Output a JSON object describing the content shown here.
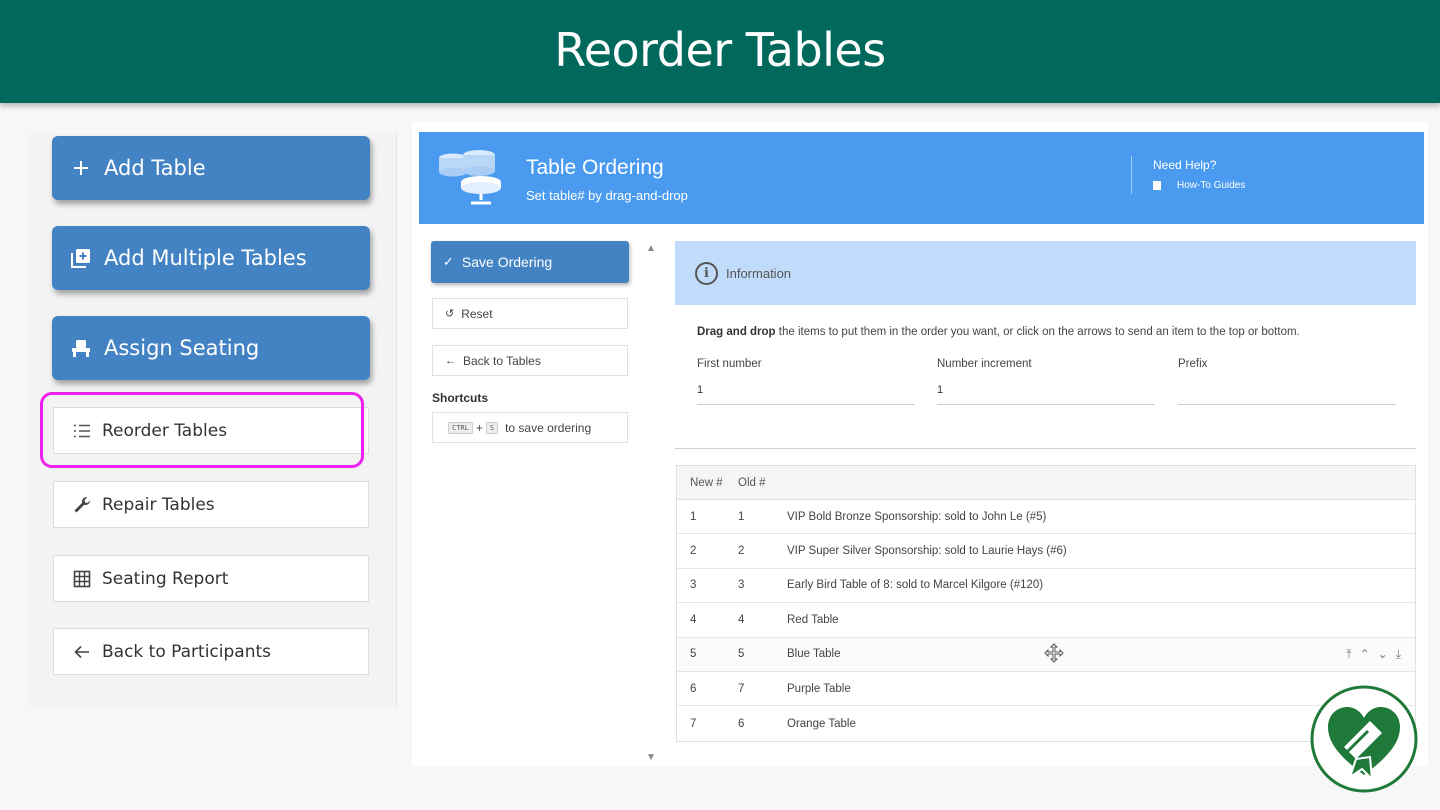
{
  "banner": {
    "title": "Reorder Tables"
  },
  "left_menu": {
    "add_table": "Add Table",
    "add_multiple": "Add Multiple Tables",
    "assign_seating": "Assign Seating",
    "reorder_tables": "Reorder Tables",
    "repair_tables": "Repair Tables",
    "seating_report": "Seating Report",
    "back_participants": "Back to Participants"
  },
  "header": {
    "title": "Table Ordering",
    "subtitle": "Set table# by drag-and-drop",
    "help_title": "Need Help?",
    "help_link": "How-To Guides"
  },
  "sidebar": {
    "save": "Save Ordering",
    "reset": "Reset",
    "back": "Back to Tables",
    "shortcuts_title": "Shortcuts",
    "key_ctrl": "CTRL",
    "key_plus": "+",
    "key_s": "S",
    "shortcut_desc": "to save ordering"
  },
  "info": {
    "title": "Information",
    "desc_bold": "Drag and drop",
    "desc_rest": " the items to put them in the order you want, or click on the arrows to send an item to the top or bottom.",
    "fields": [
      {
        "label": "First number",
        "value": "1"
      },
      {
        "label": "Number increment",
        "value": "1"
      },
      {
        "label": "Prefix",
        "value": ""
      }
    ]
  },
  "table": {
    "headers": {
      "new": "New #",
      "old": "Old #"
    },
    "rows": [
      {
        "new": "1",
        "old": "1",
        "name": "VIP Bold Bronze Sponsorship: sold to John Le (#5)"
      },
      {
        "new": "2",
        "old": "2",
        "name": "VIP Super Silver Sponsorship: sold to Laurie Hays (#6)"
      },
      {
        "new": "3",
        "old": "3",
        "name": "Early Bird Table of 8: sold to Marcel Kilgore (#120)"
      },
      {
        "new": "4",
        "old": "4",
        "name": "Red Table"
      },
      {
        "new": "5",
        "old": "5",
        "name": "Blue Table"
      },
      {
        "new": "6",
        "old": "7",
        "name": "Purple Table"
      },
      {
        "new": "7",
        "old": "6",
        "name": "Orange Table"
      }
    ]
  },
  "icons": {
    "add": "plus-icon",
    "add_multiple": "library-add-icon",
    "seating": "seat-icon",
    "reorder": "list-numbered-icon",
    "repair": "wrench-icon",
    "report": "grid-icon",
    "back": "arrow-left-icon",
    "info": "info-icon",
    "move": "move-icon"
  },
  "colors": {
    "banner": "#00695c",
    "primary": "#4383c4",
    "header": "#4a9bf0",
    "info_bg": "#c1dcfa",
    "highlight": "#ee22ee",
    "badge": "#1f7a3a"
  }
}
